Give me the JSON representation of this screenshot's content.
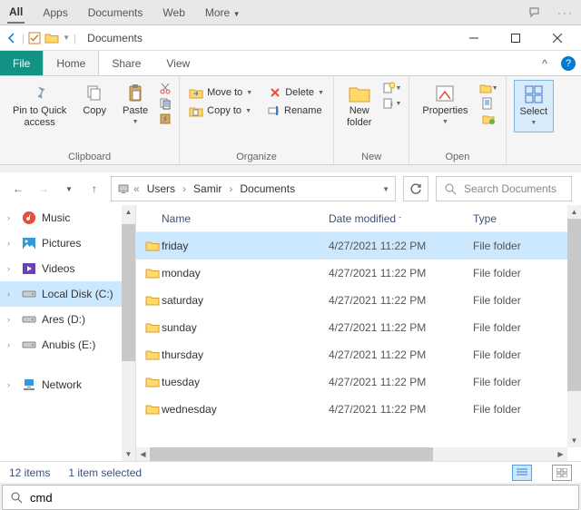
{
  "sys": {
    "items": [
      "All",
      "Apps",
      "Documents",
      "Web",
      "More"
    ],
    "active_index": 0
  },
  "titlebar": {
    "title": "Documents"
  },
  "tabs": {
    "file": "File",
    "home": "Home",
    "share": "Share",
    "view": "View"
  },
  "ribbon": {
    "clipboard": {
      "pin": "Pin to Quick\naccess",
      "copy": "Copy",
      "paste": "Paste",
      "group_label": "Clipboard"
    },
    "organize": {
      "move": "Move to",
      "copy_to": "Copy to",
      "delete": "Delete",
      "rename": "Rename",
      "group_label": "Organize"
    },
    "new": {
      "newfolder": "New\nfolder",
      "group_label": "New"
    },
    "open": {
      "properties": "Properties",
      "group_label": "Open"
    },
    "select": {
      "select": "Select",
      "group_label": ""
    }
  },
  "nav": {
    "crumbs": [
      "Users",
      "Samir",
      "Documents"
    ],
    "search_placeholder": "Search Documents"
  },
  "sidebar": {
    "items": [
      {
        "label": "Music",
        "icon": "music",
        "color": "#e74c3c"
      },
      {
        "label": "Pictures",
        "icon": "pictures",
        "color": "#3498db"
      },
      {
        "label": "Videos",
        "icon": "videos",
        "color": "#6c3fb5"
      },
      {
        "label": "Local Disk (C:)",
        "icon": "disk",
        "color": "#999",
        "selected": true
      },
      {
        "label": "Ares (D:)",
        "icon": "disk",
        "color": "#999"
      },
      {
        "label": "Anubis (E:)",
        "icon": "disk",
        "color": "#999"
      },
      {
        "label": "Network",
        "icon": "network",
        "color": "#3498db",
        "spacer_before": true
      }
    ]
  },
  "columns": {
    "name": "Name",
    "date": "Date modified",
    "type": "Type"
  },
  "files": [
    {
      "name": "friday",
      "date": "4/27/2021 11:22 PM",
      "type": "File folder",
      "selected": true
    },
    {
      "name": "monday",
      "date": "4/27/2021 11:22 PM",
      "type": "File folder"
    },
    {
      "name": "saturday",
      "date": "4/27/2021 11:22 PM",
      "type": "File folder"
    },
    {
      "name": "sunday",
      "date": "4/27/2021 11:22 PM",
      "type": "File folder"
    },
    {
      "name": "thursday",
      "date": "4/27/2021 11:22 PM",
      "type": "File folder"
    },
    {
      "name": "tuesday",
      "date": "4/27/2021 11:22 PM",
      "type": "File folder"
    },
    {
      "name": "wednesday",
      "date": "4/27/2021 11:22 PM",
      "type": "File folder"
    }
  ],
  "status": {
    "count": "12 items",
    "selected": "1 item selected"
  },
  "cmd": {
    "value": "cmd"
  }
}
